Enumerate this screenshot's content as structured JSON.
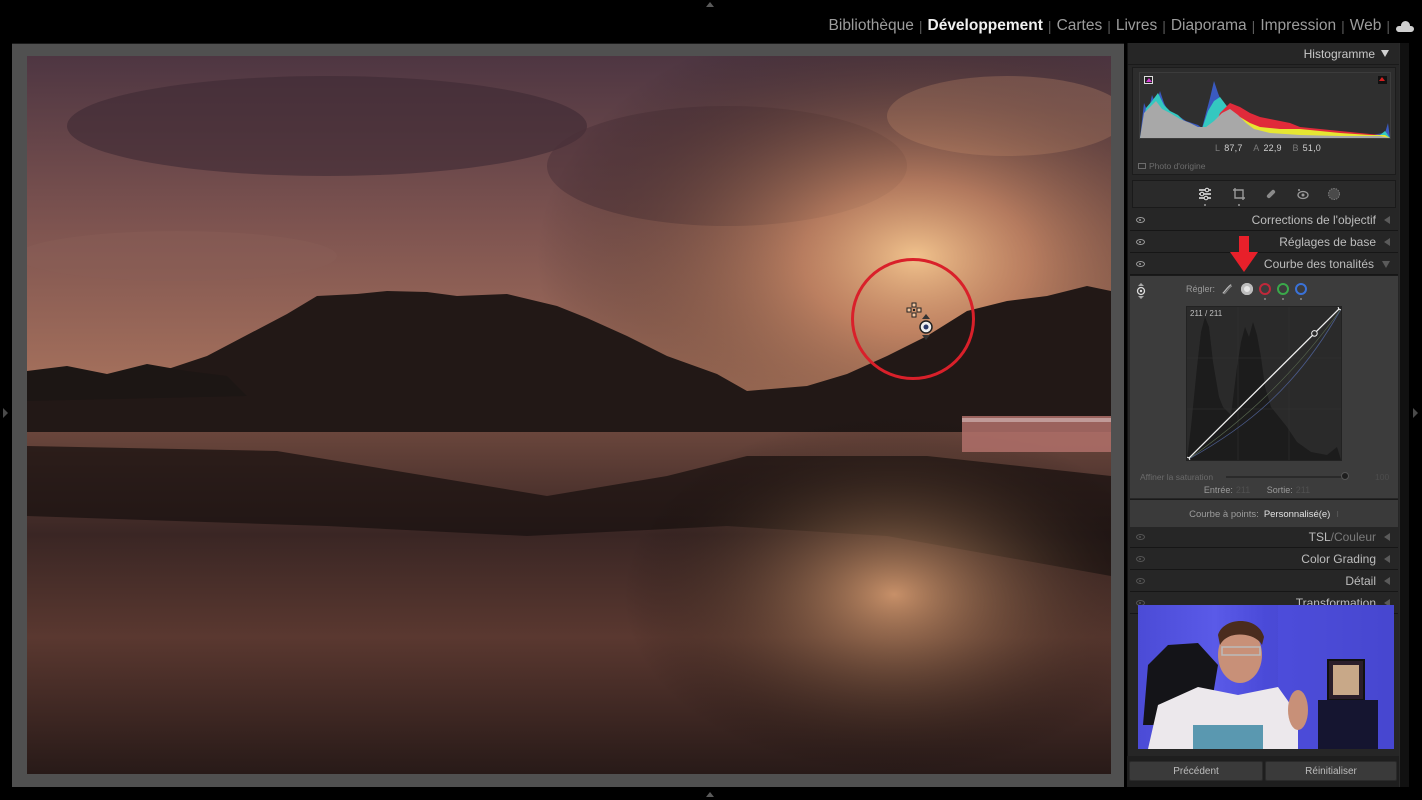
{
  "modules": {
    "items": [
      {
        "label": "Bibliothèque",
        "active": false
      },
      {
        "label": "Développement",
        "active": true
      },
      {
        "label": "Cartes",
        "active": false
      },
      {
        "label": "Livres",
        "active": false
      },
      {
        "label": "Diaporama",
        "active": false
      },
      {
        "label": "Impression",
        "active": false
      },
      {
        "label": "Web",
        "active": false
      }
    ],
    "separator": "|",
    "cloud_icon": "cloud-icon"
  },
  "histogram": {
    "title": "Histogramme",
    "readout": {
      "L_label": "L",
      "L": "87,7",
      "A_label": "A",
      "A": "22,9",
      "B_label": "B",
      "B": "51,0"
    },
    "original_photo_label": "Photo d'origine"
  },
  "tools": [
    {
      "name": "edit-sliders-icon",
      "active": true
    },
    {
      "name": "crop-icon",
      "active": false
    },
    {
      "name": "healing-icon",
      "active": false
    },
    {
      "name": "red-eye-icon",
      "active": false
    },
    {
      "name": "masking-icon",
      "active": false
    }
  ],
  "sections": {
    "lens": "Corrections de l'objectif",
    "basic": "Réglages de base",
    "tone_curve": "Courbe des tonalités",
    "hsl": "TSL",
    "hsl_sep": " / ",
    "hsl_color": "Couleur",
    "color_grading": "Color Grading",
    "detail": "Détail",
    "transform": "Transformation"
  },
  "tone_curve": {
    "adjust_label": "Régler:",
    "channels": [
      {
        "name": "parametric",
        "color": "#9a9a9a"
      },
      {
        "name": "point-rgb",
        "color": "#e6e6e6",
        "selected": true
      },
      {
        "name": "red",
        "color": "#c0283a"
      },
      {
        "name": "green",
        "color": "#3aa84a"
      },
      {
        "name": "blue",
        "color": "#3a72d8"
      }
    ],
    "curve_readout": "211 / 211",
    "curve_points": [
      [
        0,
        0
      ],
      [
        211,
        211
      ],
      [
        255,
        255
      ]
    ],
    "refine_saturation_label": "Affiner la saturation",
    "refine_saturation_value": "100",
    "input_label": "Entrée:",
    "input_value": "211",
    "output_label": "Sortie:",
    "output_value": "211",
    "point_curve_label": "Courbe à points:",
    "point_curve_value": "Personnalisé(e)"
  },
  "footer": {
    "previous_label": "Précédent",
    "reset_label": "Réinitialiser"
  },
  "annotations": {
    "highlight_color": "#d9202a"
  }
}
